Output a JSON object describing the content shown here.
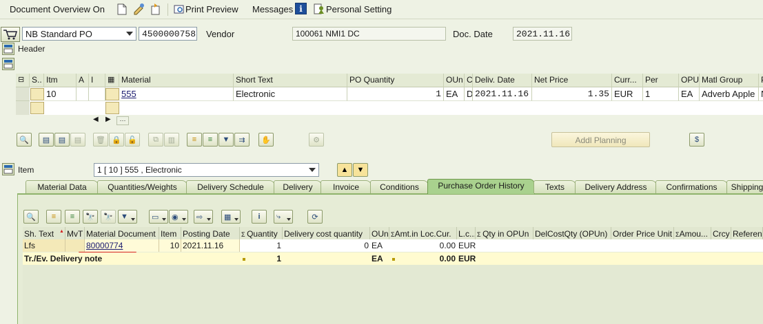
{
  "toolbar": {
    "doc_overview": "Document Overview On",
    "print_preview": "Print Preview",
    "messages": "Messages",
    "personal_setting": "Personal Setting"
  },
  "header_row": {
    "doc_type": "NB Standard PO",
    "po_number": "4500000758",
    "vendor_label": "Vendor",
    "vendor_value": "100061 NMI1 DC",
    "doc_date_label": "Doc. Date",
    "doc_date_value": "2021.11.16"
  },
  "header_section": "Header",
  "item_grid": {
    "columns": [
      "S..",
      "Itm",
      "A",
      "I",
      "Material",
      "Short Text",
      "PO Quantity",
      "OUn",
      "C",
      "Deliv. Date",
      "Net Price",
      "Curr...",
      "Per",
      "OPU",
      "Matl Group",
      "P"
    ],
    "row": {
      "itm": "10",
      "material": "555",
      "short_text": "Electronic",
      "po_qty": "1",
      "oun": "EA",
      "c": "D",
      "deliv_date": "2021.11.16",
      "net_price": "1.35",
      "curr": "EUR",
      "per": "1",
      "opu": "EA",
      "matl_group": "Adverb Apple",
      "p": "N"
    }
  },
  "addl_planning": "Addl Planning",
  "item_selector": {
    "label": "Item",
    "value": "1 [ 10 ] 555 , Electronic"
  },
  "tabs": [
    "Material Data",
    "Quantities/Weights",
    "Delivery Schedule",
    "Delivery",
    "Invoice",
    "Conditions",
    "Purchase Order History",
    "Texts",
    "Delivery Address",
    "Confirmations",
    "Shipping"
  ],
  "history": {
    "columns": [
      "Sh. Text",
      "MvT",
      "Material Document",
      "Item",
      "Posting Date",
      "Quantity",
      "Delivery cost quantity",
      "OUn",
      "Amt.in Loc.Cur.",
      "L.c...",
      "Qty in OPUn",
      "DelCostQty (OPUn)",
      "Order Price Unit",
      "Amou...",
      "Crcy",
      "Referen"
    ],
    "row": {
      "sh_text": "Lfs",
      "mvt": "",
      "mat_doc": "80000774",
      "item": "10",
      "posting_date": "2021.11.16",
      "quantity": "1",
      "del_cost_qty": "0",
      "oun": "EA",
      "amt": "0.00",
      "lc": "EUR"
    },
    "total": {
      "label": "Tr./Ev. Delivery note",
      "quantity": "1",
      "oun": "EA",
      "amt": "0.00",
      "lc": "EUR"
    }
  },
  "colors": {
    "background": "#eef2e4",
    "active_tab": "#a9d18e",
    "total_row": "#fffbd0",
    "highlight": "#f4e9b8",
    "underline": "#d42020"
  }
}
